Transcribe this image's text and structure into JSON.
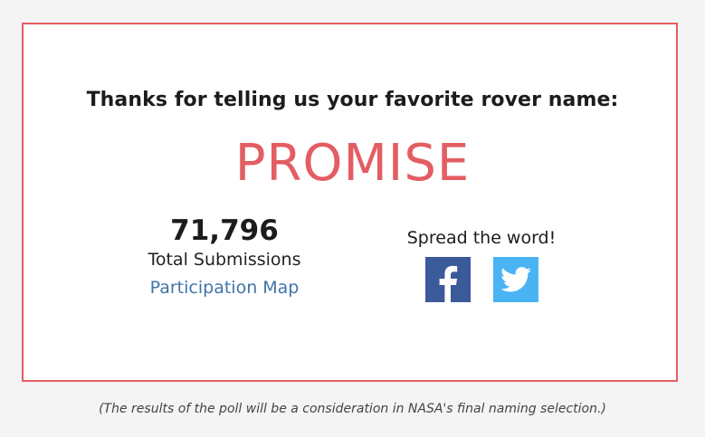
{
  "confirmation": {
    "heading": "Thanks for telling us your favorite rover name:",
    "rover_name": "PROMISE"
  },
  "stats": {
    "total_count": "71,796",
    "total_label": "Total Submissions",
    "map_link_label": "Participation Map"
  },
  "share": {
    "label": "Spread the word!",
    "buttons": [
      {
        "network": "facebook",
        "icon": "facebook-icon",
        "color": "#3b5a9a"
      },
      {
        "network": "twitter",
        "icon": "twitter-bird-icon",
        "color": "#4ab3f4"
      }
    ]
  },
  "footer": {
    "disclaimer": "(The results of the poll will be a consideration in NASA's final naming selection.)"
  },
  "colors": {
    "accent": "#e35d62",
    "link": "#3f75a8",
    "background": "#f4f4f5"
  }
}
